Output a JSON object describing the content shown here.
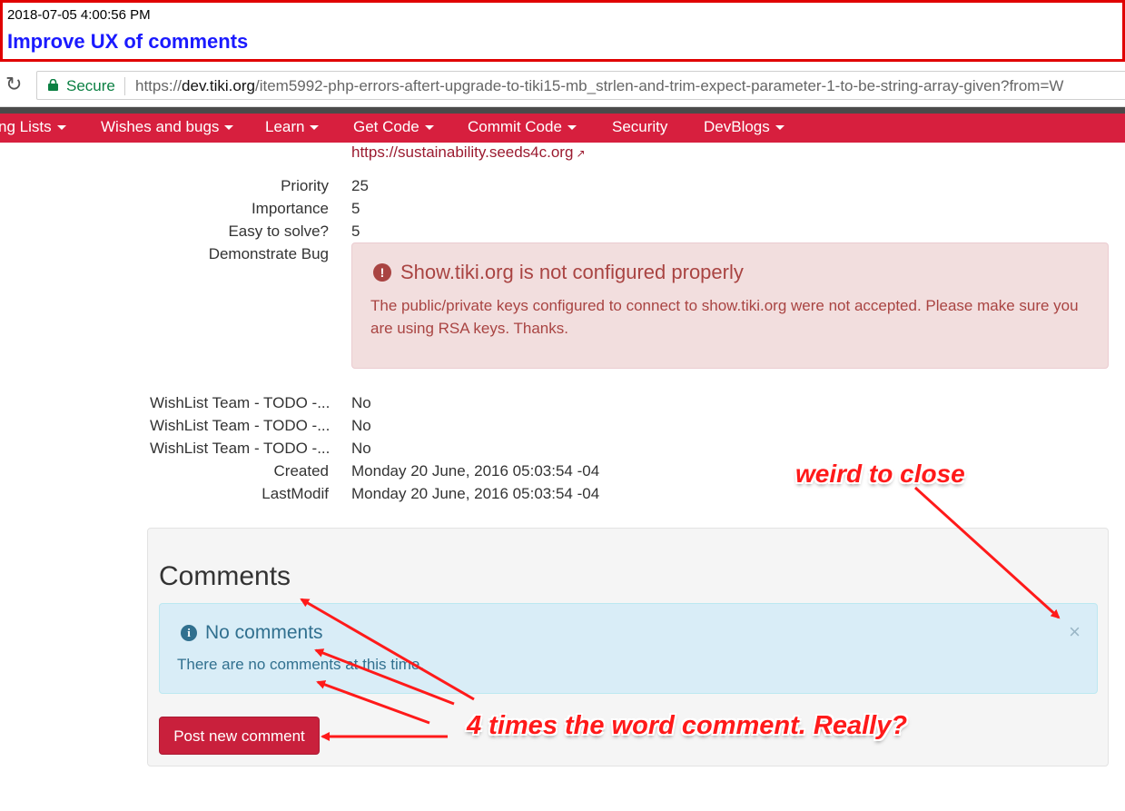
{
  "note": {
    "timestamp": "2018-07-05 4:00:56 PM",
    "title": "Improve UX of comments"
  },
  "browser": {
    "secure_label": "Secure",
    "url_scheme": "https://",
    "url_host": "dev.tiki.org",
    "url_path": "/item5992-php-errors-aftert-upgrade-to-tiki15-mb_strlen-and-trim-expect-parameter-1-to-be-string-array-given?from=W"
  },
  "nav": {
    "items": [
      {
        "label": "ng Lists",
        "dropdown": true
      },
      {
        "label": "Wishes and bugs",
        "dropdown": true
      },
      {
        "label": "Learn",
        "dropdown": true
      },
      {
        "label": "Get Code",
        "dropdown": true
      },
      {
        "label": "Commit Code",
        "dropdown": true
      },
      {
        "label": "Security",
        "dropdown": false
      },
      {
        "label": "DevBlogs",
        "dropdown": true
      }
    ],
    "color": "#d71f3e"
  },
  "item": {
    "top_link": "https://sustainability.seeds4c.org",
    "fields": [
      {
        "label": "Priority",
        "value": "25"
      },
      {
        "label": "Importance",
        "value": "5"
      },
      {
        "label": "Easy to solve?",
        "value": "5"
      },
      {
        "label": "Demonstrate Bug",
        "value": ""
      }
    ],
    "demo_alert": {
      "title": "Show.tiki.org is not configured properly",
      "body": "The public/private keys configured to connect to show.tiki.org were not accepted. Please make sure you are using RSA keys. Thanks."
    },
    "fields2": [
      {
        "label": "WishList Team - TODO -...",
        "value": "No"
      },
      {
        "label": "WishList Team - TODO -...",
        "value": "No"
      },
      {
        "label": "WishList Team - TODO -...",
        "value": "No"
      },
      {
        "label": "Created",
        "value": "Monday 20 June, 2016 05:03:54 -04"
      },
      {
        "label": "LastModif",
        "value": "Monday 20 June, 2016 05:03:54 -04"
      }
    ]
  },
  "comments": {
    "heading": "Comments",
    "info_title": "No comments",
    "info_body": "There are no comments at this time.",
    "close_symbol": "×",
    "post_button": "Post new comment"
  },
  "annotations": {
    "close_note": "weird to close",
    "comment_note": "4 times the word comment. Really?",
    "color": "#ff1a1a"
  }
}
